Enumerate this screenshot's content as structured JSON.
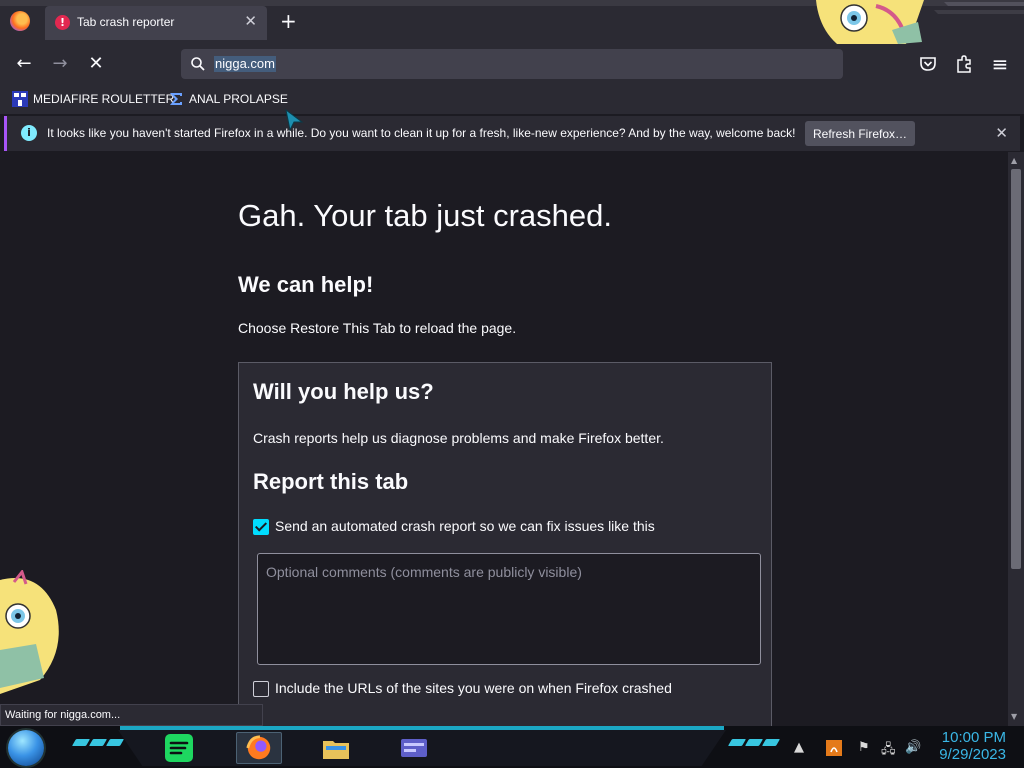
{
  "browser": {
    "tab": {
      "title": "Tab crash reporter",
      "close": "✕"
    },
    "newtab": "+",
    "url": "nigga.com",
    "nav": {
      "back": "←",
      "forward": "→",
      "stop": "✕"
    },
    "menu": "≡"
  },
  "bookmarks": [
    {
      "label": "MEDIAFIRE ROULETTER"
    },
    {
      "label": "ANAL PROLAPSE"
    }
  ],
  "notification": {
    "icon": "i",
    "message": "It looks like you haven't started Firefox in a while. Do you want to clean it up for a fresh, like-new experience? And by the way, welcome back!",
    "button": "Refresh Firefox…",
    "close": "✕"
  },
  "crash": {
    "title": "Gah. Your tab just crashed.",
    "help_heading": "We can help!",
    "help_text": "Choose Restore This Tab to reload the page.",
    "card": {
      "heading": "Will you help us?",
      "text": "Crash reports help us diagnose problems and make Firefox better.",
      "report_heading": "Report this tab",
      "send_report_label": "Send an automated crash report so we can fix issues like this",
      "send_report_checked": true,
      "comments_placeholder": "Optional comments (comments are publicly visible)",
      "include_urls_label": "Include the URLs of the sites you were on when Firefox crashed",
      "include_urls_checked": false
    }
  },
  "status": "Waiting for nigga.com...",
  "taskbar": {
    "time": "10:00 PM",
    "date": "9/29/2023"
  },
  "colors": {
    "accent": "#00ddff",
    "bg": "#1c1b22",
    "chrome": "#2b2a33",
    "clock": "#3ab7e6"
  }
}
